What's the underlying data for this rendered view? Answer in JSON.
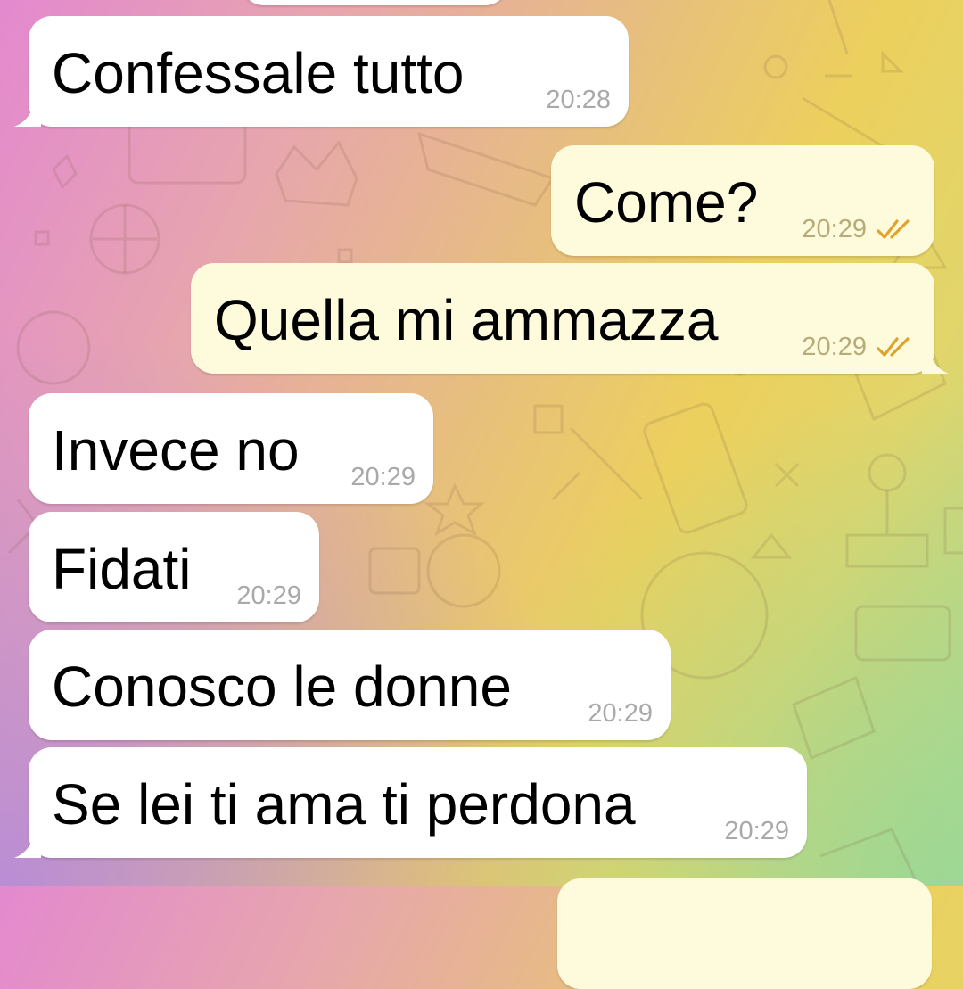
{
  "chat": {
    "messages": [
      {
        "text": "Confessale tutto",
        "time": "20:28",
        "direction": "incoming"
      },
      {
        "text": "Come?",
        "time": "20:29",
        "direction": "outgoing",
        "status": "read"
      },
      {
        "text": "Quella mi ammazza",
        "time": "20:29",
        "direction": "outgoing",
        "status": "read"
      },
      {
        "text": "Invece no",
        "time": "20:29",
        "direction": "incoming"
      },
      {
        "text": "Fidati",
        "time": "20:29",
        "direction": "incoming"
      },
      {
        "text": "Conosco le donne",
        "time": "20:29",
        "direction": "incoming"
      },
      {
        "text": "Se lei ti ama ti perdona",
        "time": "20:29",
        "direction": "incoming"
      }
    ]
  },
  "colors": {
    "incoming_bubble": "#ffffff",
    "outgoing_bubble": "#fefbdc",
    "read_check": "#e0a22a",
    "time_text": "#a9a9a9"
  },
  "icons": {
    "read_status": "double-check-icon"
  }
}
